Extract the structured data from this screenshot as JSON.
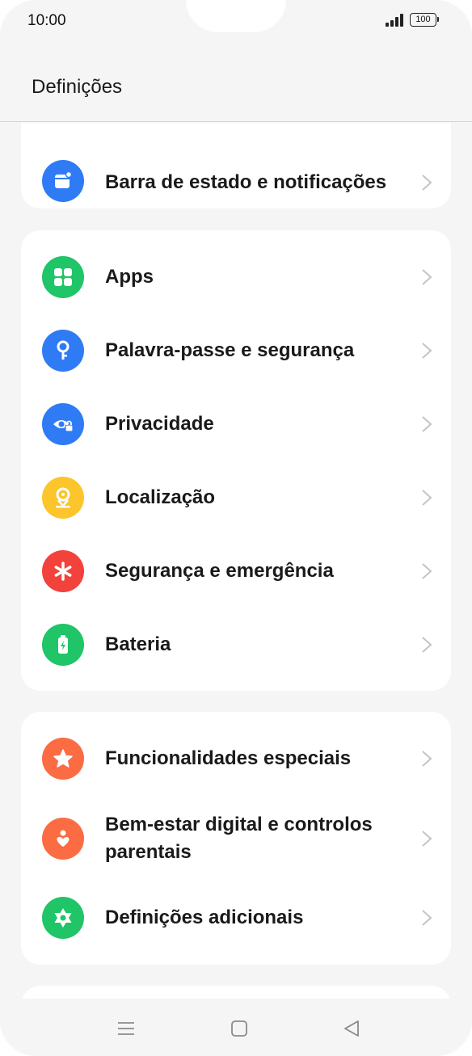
{
  "status_bar": {
    "time": "10:00",
    "battery": "100"
  },
  "header": {
    "title": "Definições"
  },
  "colors": {
    "blue": "#2f7bf5",
    "green": "#1fc566",
    "yellow": "#fbc52b",
    "red": "#f2423b",
    "orange": "#fb6c43",
    "chevron": "#c4c4c4"
  },
  "groups": [
    {
      "items": [
        {
          "label": "Barra de estado e notificações",
          "icon": "status-bar-icon",
          "color": "#2f7bf5"
        }
      ]
    },
    {
      "items": [
        {
          "label": "Apps",
          "icon": "apps-grid-icon",
          "color": "#1fc566"
        },
        {
          "label": "Palavra-passe e segurança",
          "icon": "key-icon",
          "color": "#2f7bf5"
        },
        {
          "label": "Privacidade",
          "icon": "eye-lock-icon",
          "color": "#2f7bf5"
        },
        {
          "label": "Localização",
          "icon": "location-pin-icon",
          "color": "#fbc52b"
        },
        {
          "label": "Segurança e emergência",
          "icon": "asterisk-icon",
          "color": "#f2423b"
        },
        {
          "label": "Bateria",
          "icon": "battery-charging-icon",
          "color": "#1fc566"
        }
      ]
    },
    {
      "items": [
        {
          "label": "Funcionalidades especiais",
          "icon": "star-icon",
          "color": "#fb6c43"
        },
        {
          "label": "Bem-estar digital e controlos parentais",
          "icon": "heart-person-icon",
          "color": "#fb6c43"
        },
        {
          "label": "Definições adicionais",
          "icon": "gear-icon",
          "color": "#1fc566"
        }
      ]
    }
  ],
  "nav": {
    "menu": "menu-icon",
    "home": "home-icon",
    "back": "back-icon"
  }
}
